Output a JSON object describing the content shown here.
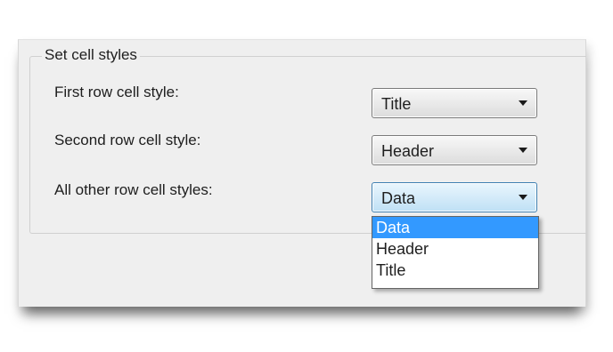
{
  "group": {
    "legend": "Set cell styles"
  },
  "rows": [
    {
      "label": "First row cell style:",
      "value": "Title"
    },
    {
      "label": "Second row cell style:",
      "value": "Header"
    },
    {
      "label": "All other row cell styles:",
      "value": "Data"
    }
  ],
  "dropdown": {
    "options": [
      "Data",
      "Header",
      "Title"
    ],
    "selected": "Data"
  },
  "colors": {
    "highlight": "#3399ff",
    "panel": "#efefef"
  }
}
